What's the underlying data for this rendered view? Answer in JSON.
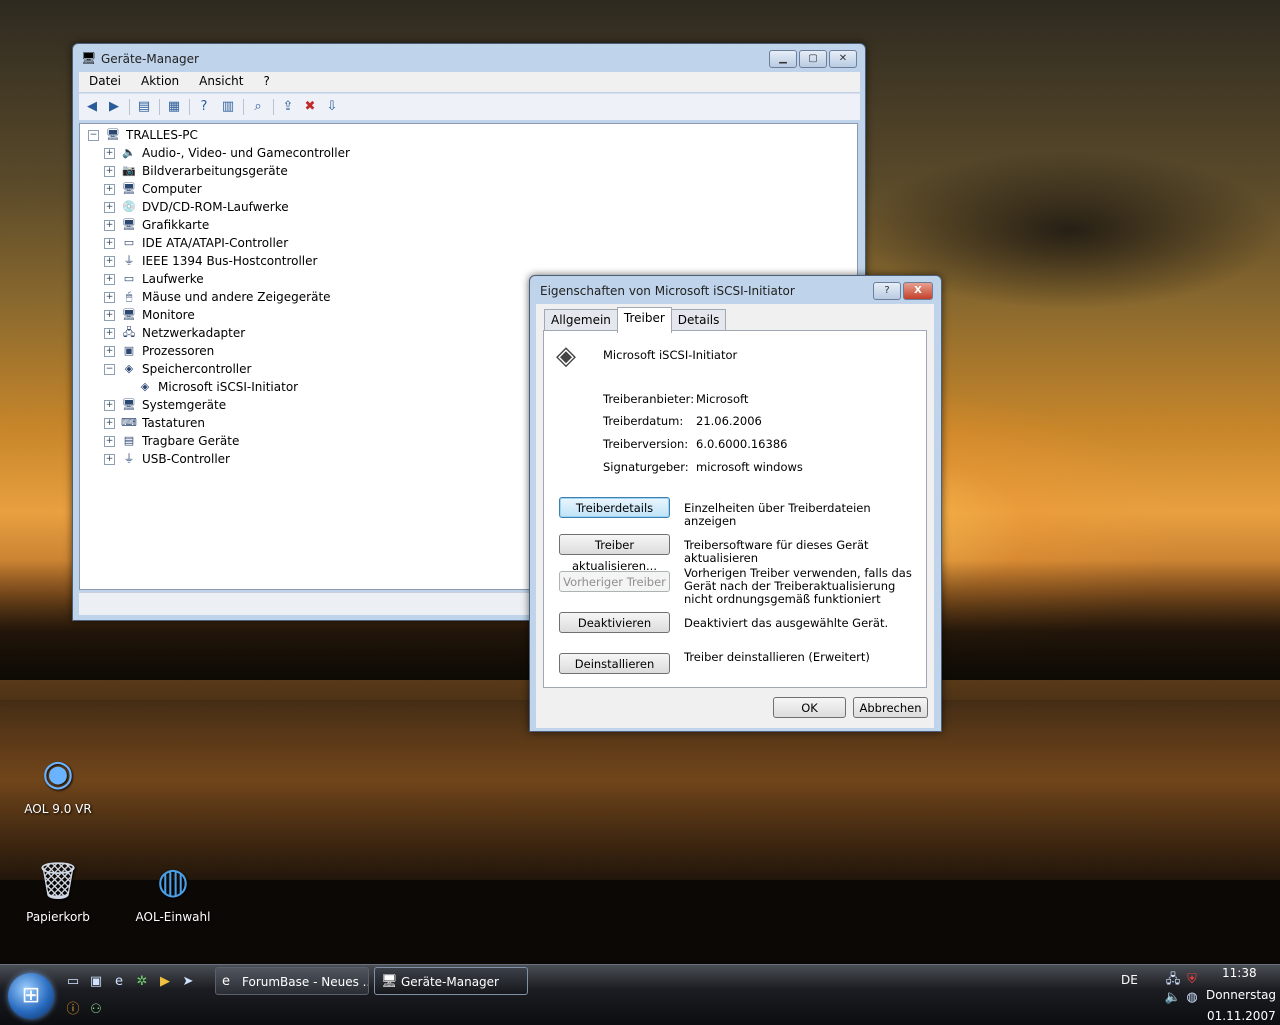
{
  "device_manager": {
    "title": "Geräte-Manager",
    "menu": [
      "Datei",
      "Aktion",
      "Ansicht",
      "?"
    ],
    "root": "TRALLES-PC",
    "tree": [
      {
        "label": "Audio-, Video- und Gamecontroller",
        "icon": "speaker-icon",
        "glyph": "🔈"
      },
      {
        "label": "Bildverarbeitungsgeräte",
        "icon": "camera-icon",
        "glyph": "📷"
      },
      {
        "label": "Computer",
        "icon": "computer-icon",
        "glyph": "🖥"
      },
      {
        "label": "DVD/CD-ROM-Laufwerke",
        "icon": "disc-drive-icon",
        "glyph": "💿"
      },
      {
        "label": "Grafikkarte",
        "icon": "display-adapter-icon",
        "glyph": "🖥"
      },
      {
        "label": "IDE ATA/ATAPI-Controller",
        "icon": "ide-controller-icon",
        "glyph": "▭"
      },
      {
        "label": "IEEE 1394 Bus-Hostcontroller",
        "icon": "firewire-icon",
        "glyph": "⏚"
      },
      {
        "label": "Laufwerke",
        "icon": "disk-drive-icon",
        "glyph": "▭"
      },
      {
        "label": "Mäuse und andere Zeigegeräte",
        "icon": "mouse-icon",
        "glyph": "🖱"
      },
      {
        "label": "Monitore",
        "icon": "monitor-icon",
        "glyph": "🖥"
      },
      {
        "label": "Netzwerkadapter",
        "icon": "network-adapter-icon",
        "glyph": "🖧"
      },
      {
        "label": "Prozessoren",
        "icon": "processor-icon",
        "glyph": "▣"
      },
      {
        "label": "Speichercontroller",
        "icon": "storage-controller-icon",
        "glyph": "◈",
        "expanded": true
      },
      {
        "label": "Microsoft iSCSI-Initiator",
        "icon": "iscsi-icon",
        "glyph": "◈",
        "child": true
      },
      {
        "label": "Systemgeräte",
        "icon": "system-device-icon",
        "glyph": "🖥"
      },
      {
        "label": "Tastaturen",
        "icon": "keyboard-icon",
        "glyph": "⌨"
      },
      {
        "label": "Tragbare Geräte",
        "icon": "portable-device-icon",
        "glyph": "▤"
      },
      {
        "label": "USB-Controller",
        "icon": "usb-icon",
        "glyph": "⏚"
      }
    ]
  },
  "dialog": {
    "title": "Eigenschaften von Microsoft iSCSI-Initiator",
    "help_btn": "?",
    "close_btn": "X",
    "tabs": [
      "Allgemein",
      "Treiber",
      "Details"
    ],
    "device_name": "Microsoft iSCSI-Initiator",
    "fields": [
      {
        "label": "Treiberanbieter:",
        "value": "Microsoft"
      },
      {
        "label": "Treiberdatum:",
        "value": "21.06.2006"
      },
      {
        "label": "Treiberversion:",
        "value": "6.0.6000.16386"
      },
      {
        "label": "Signaturgeber:",
        "value": "microsoft windows"
      }
    ],
    "actions": [
      {
        "button": "Treiberdetails",
        "desc": "Einzelheiten über Treiberdateien anzeigen"
      },
      {
        "button": "Treiber aktualisieren...",
        "desc": "Treibersoftware für dieses Gerät aktualisieren"
      },
      {
        "button": "Vorheriger Treiber",
        "desc": "Vorherigen Treiber verwenden, falls das Gerät nach der Treiberaktualisierung nicht ordnungsgemäß funktioniert"
      },
      {
        "button": "Deaktivieren",
        "desc": "Deaktiviert das ausgewählte Gerät."
      },
      {
        "button": "Deinstallieren",
        "desc": "Treiber deinstallieren (Erweitert)"
      }
    ],
    "ok": "OK",
    "cancel": "Abbrechen"
  },
  "desktop_icons": [
    {
      "label": "AOL 9.0 VR",
      "icon": "aol-icon"
    },
    {
      "label": "Papierkorb",
      "icon": "recycle-bin-icon"
    },
    {
      "label": "AOL-Einwahl",
      "icon": "aol-dialup-icon"
    }
  ],
  "taskbar": {
    "tasks": [
      "ForumBase - Neues ...",
      "Geräte-Manager"
    ],
    "language": "DE",
    "time": "11:38",
    "day": "Donnerstag",
    "date": "01.11.2007"
  }
}
